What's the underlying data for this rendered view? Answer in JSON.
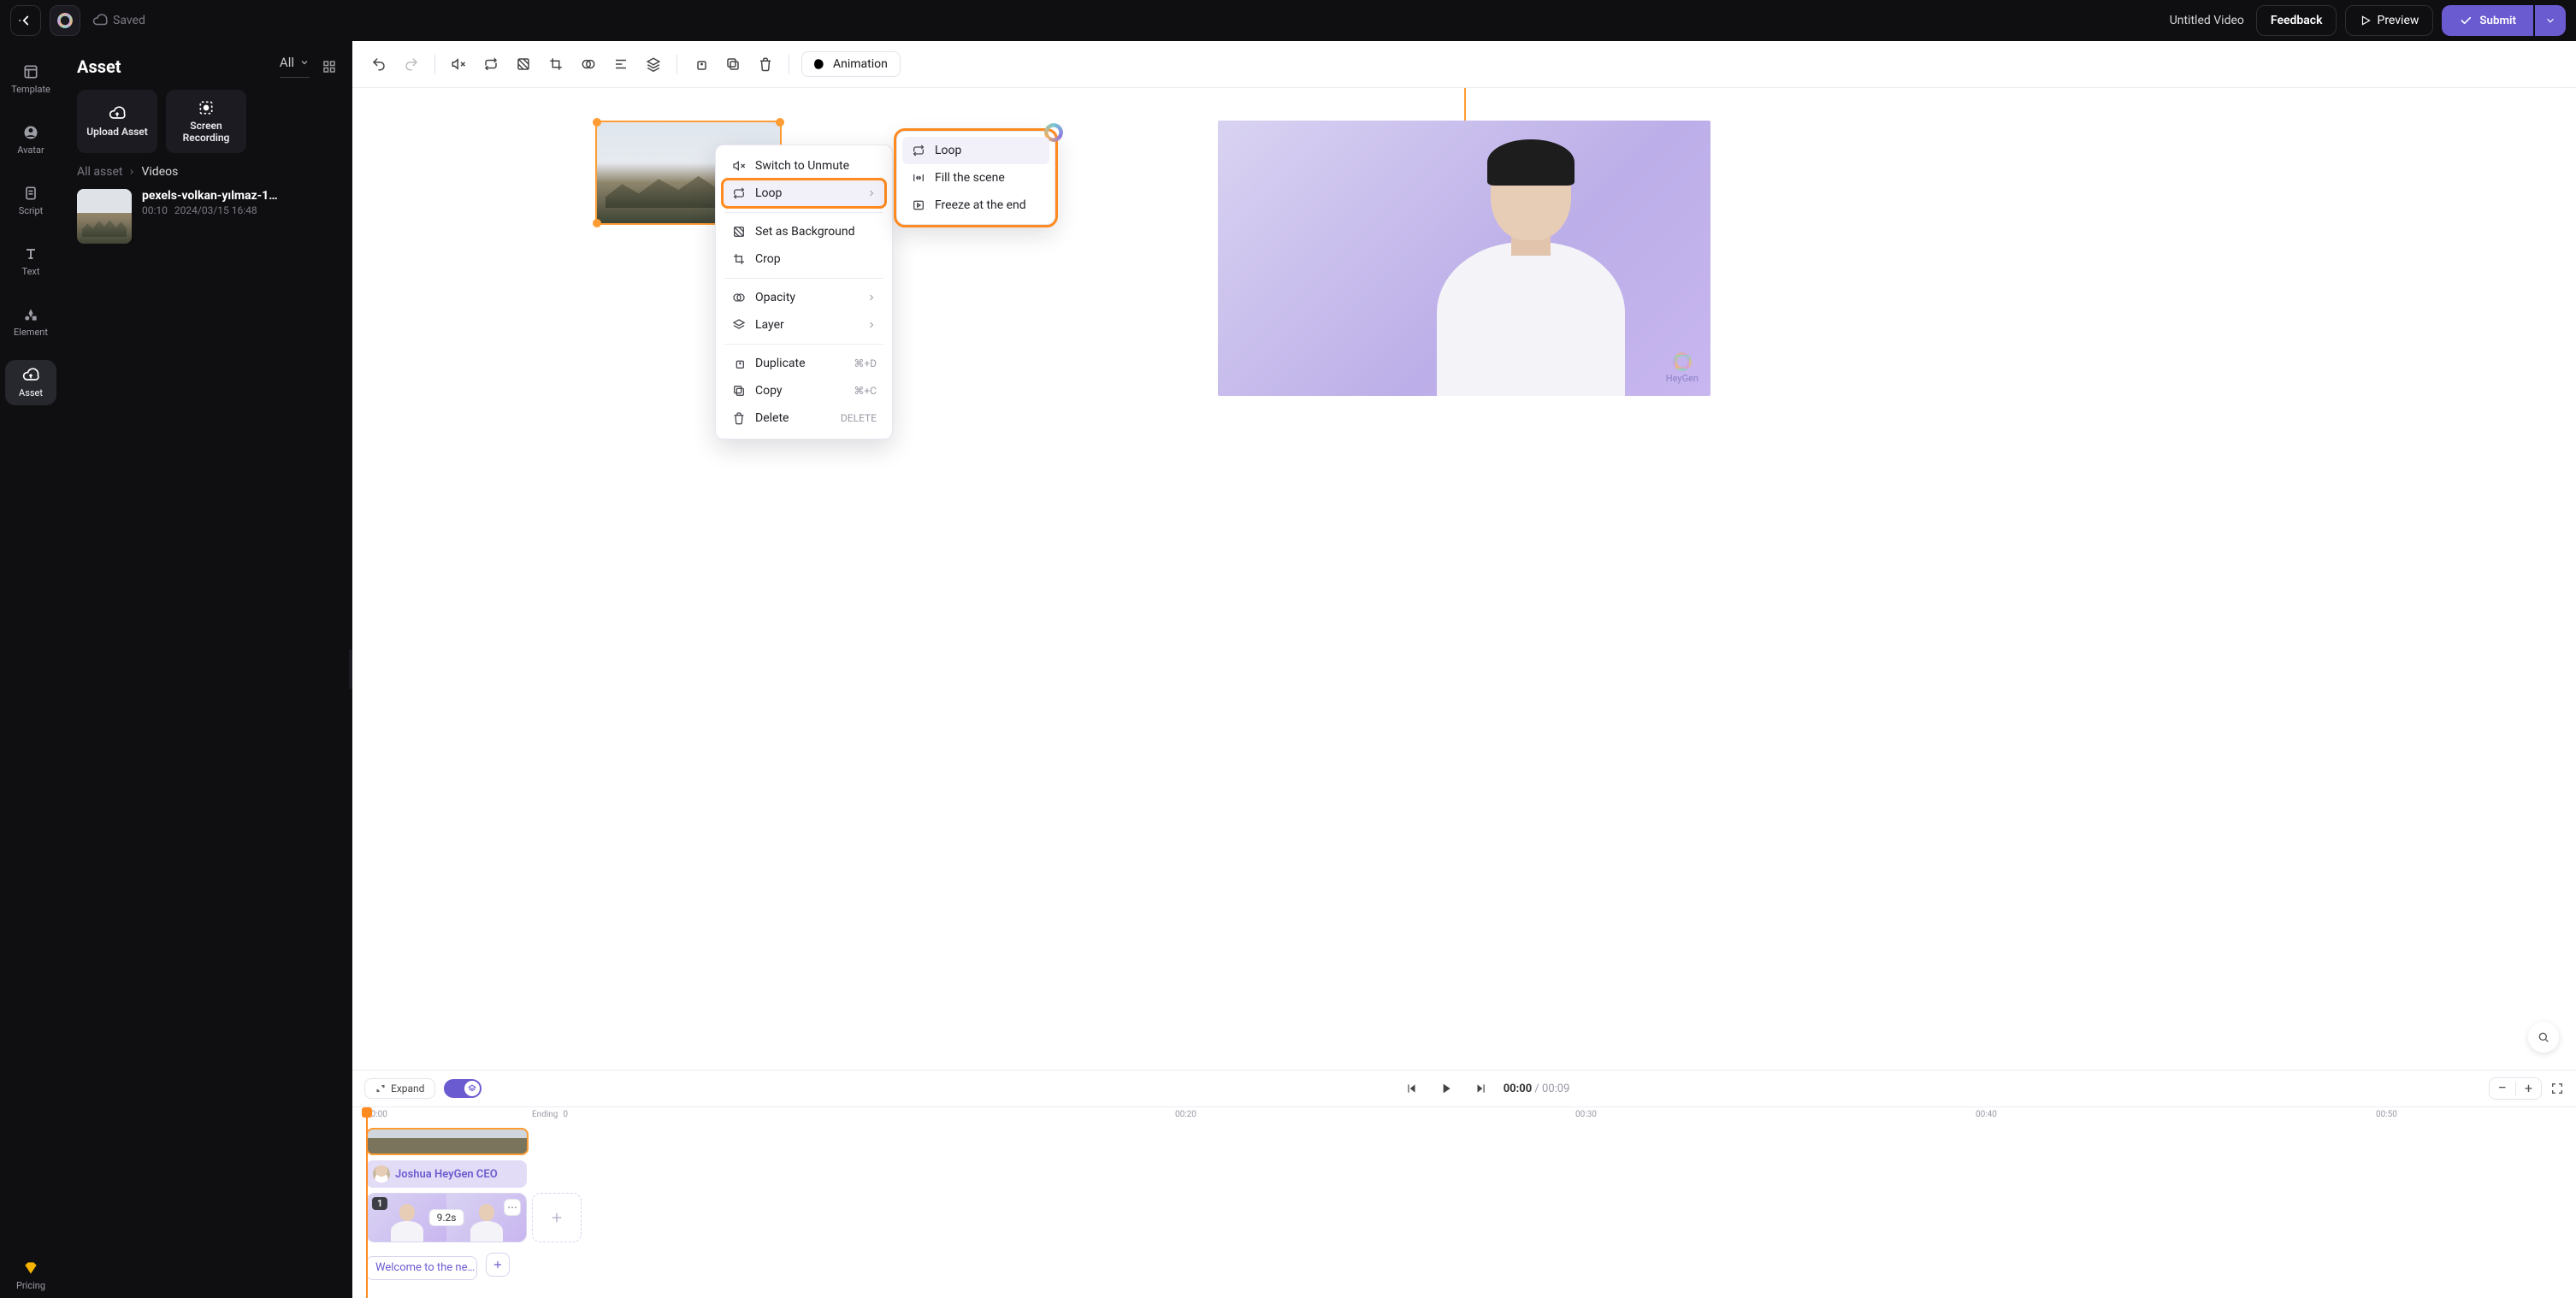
{
  "header": {
    "saved": "Saved",
    "title": "Untitled Video",
    "feedback": "Feedback",
    "preview": "Preview",
    "submit": "Submit"
  },
  "vnav": {
    "template": "Template",
    "avatar": "Avatar",
    "script": "Script",
    "text": "Text",
    "element": "Element",
    "asset": "Asset",
    "pricing": "Pricing"
  },
  "assetPanel": {
    "title": "Asset",
    "filter": "All",
    "upload": "Upload Asset",
    "record": "Screen Recording",
    "crumbRoot": "All asset",
    "crumbLeaf": "Videos",
    "item": {
      "name": "pexels-volkan-yılmaz-1…",
      "duration": "00:10",
      "date": "2024/03/15 16:48"
    }
  },
  "toolbar": {
    "animation": "Animation"
  },
  "contextMenu": {
    "unmute": "Switch to Unmute",
    "loop": "Loop",
    "setBg": "Set as Background",
    "crop": "Crop",
    "opacity": "Opacity",
    "layer": "Layer",
    "duplicate": "Duplicate",
    "copy": "Copy",
    "delete": "Delete",
    "shortcuts": {
      "duplicate": "⌘+D",
      "copy": "⌘+C",
      "delete": "DELETE"
    }
  },
  "loopSubmenu": {
    "loop": "Loop",
    "fill": "Fill the scene",
    "freeze": "Freeze at the end"
  },
  "timelineBar": {
    "expand": "Expand",
    "time": {
      "current": "00:00",
      "total": "00:09"
    }
  },
  "scene": {
    "brand": "HeyGen",
    "trackLabel": "Joshua HeyGen CEO",
    "badge": "1",
    "duration": "9.2s",
    "caption": "Welcome to the ne…"
  },
  "ruler": {
    "t0": "00:00",
    "ending": "Ending",
    "endingZero": "0",
    "marks": [
      "00:20",
      "00:30",
      "00:40",
      "00:50"
    ]
  }
}
